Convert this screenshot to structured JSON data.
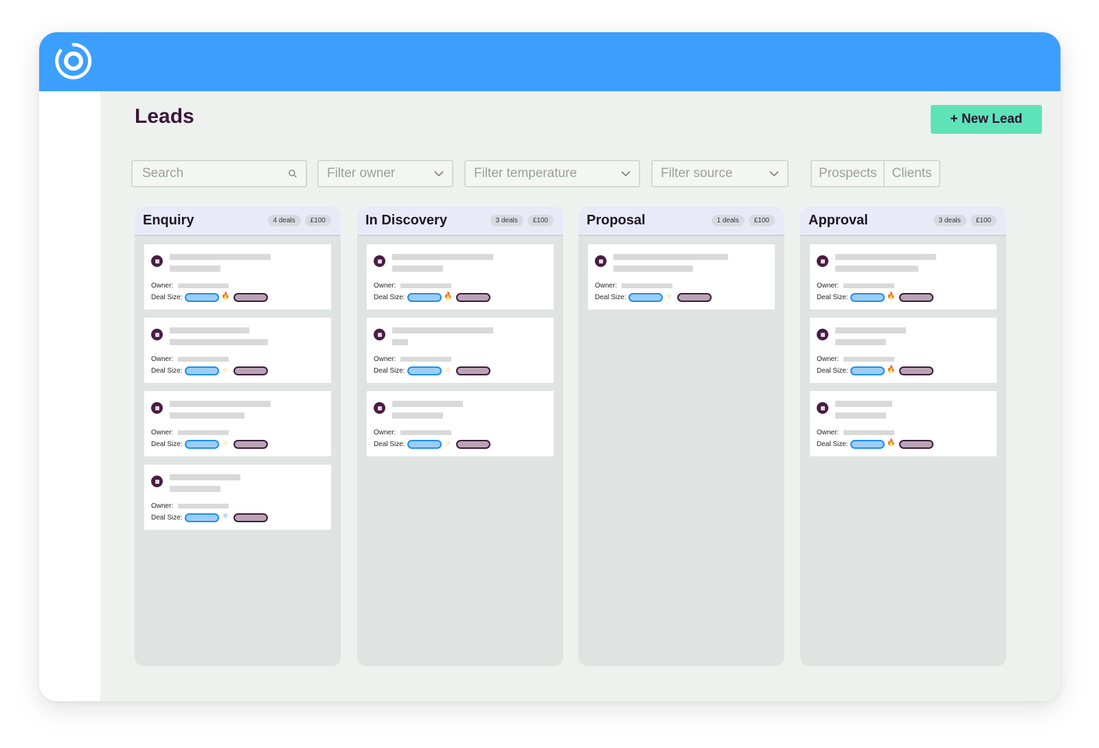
{
  "app": {
    "logo_icon": "brand-ring-logo-icon",
    "accent": "#3c9ffe",
    "cta_color": "#5ee3b8"
  },
  "page": {
    "title": "Leads",
    "new_lead_label": "+ New Lead"
  },
  "filters": {
    "search_placeholder": "Search",
    "owner": "Filter owner",
    "temperature": "Filter temperature",
    "source": "Filter source"
  },
  "view_toggle": {
    "prospects": "Prospects",
    "clients": "Clients"
  },
  "card_labels": {
    "owner": "Owner:",
    "deal_size": "Deal Size:"
  },
  "columns": [
    {
      "title": "Enquiry",
      "deals": "4 deals",
      "value": "£100",
      "cards": [
        {
          "temp": "hot"
        },
        {
          "temp": "warm"
        },
        {
          "temp": "warm"
        },
        {
          "temp": "cold"
        }
      ]
    },
    {
      "title": "In Discovery",
      "deals": "3 deals",
      "value": "£100",
      "cards": [
        {
          "temp": "hot"
        },
        {
          "temp": "warm"
        },
        {
          "temp": "warm"
        }
      ]
    },
    {
      "title": "Proposal",
      "deals": "1 deals",
      "value": "£100",
      "cards": [
        {
          "temp": "warm"
        }
      ]
    },
    {
      "title": "Approval",
      "deals": "3 deals",
      "value": "£100",
      "cards": [
        {
          "temp": "hot"
        },
        {
          "temp": "hot"
        },
        {
          "temp": "hot"
        }
      ]
    }
  ]
}
